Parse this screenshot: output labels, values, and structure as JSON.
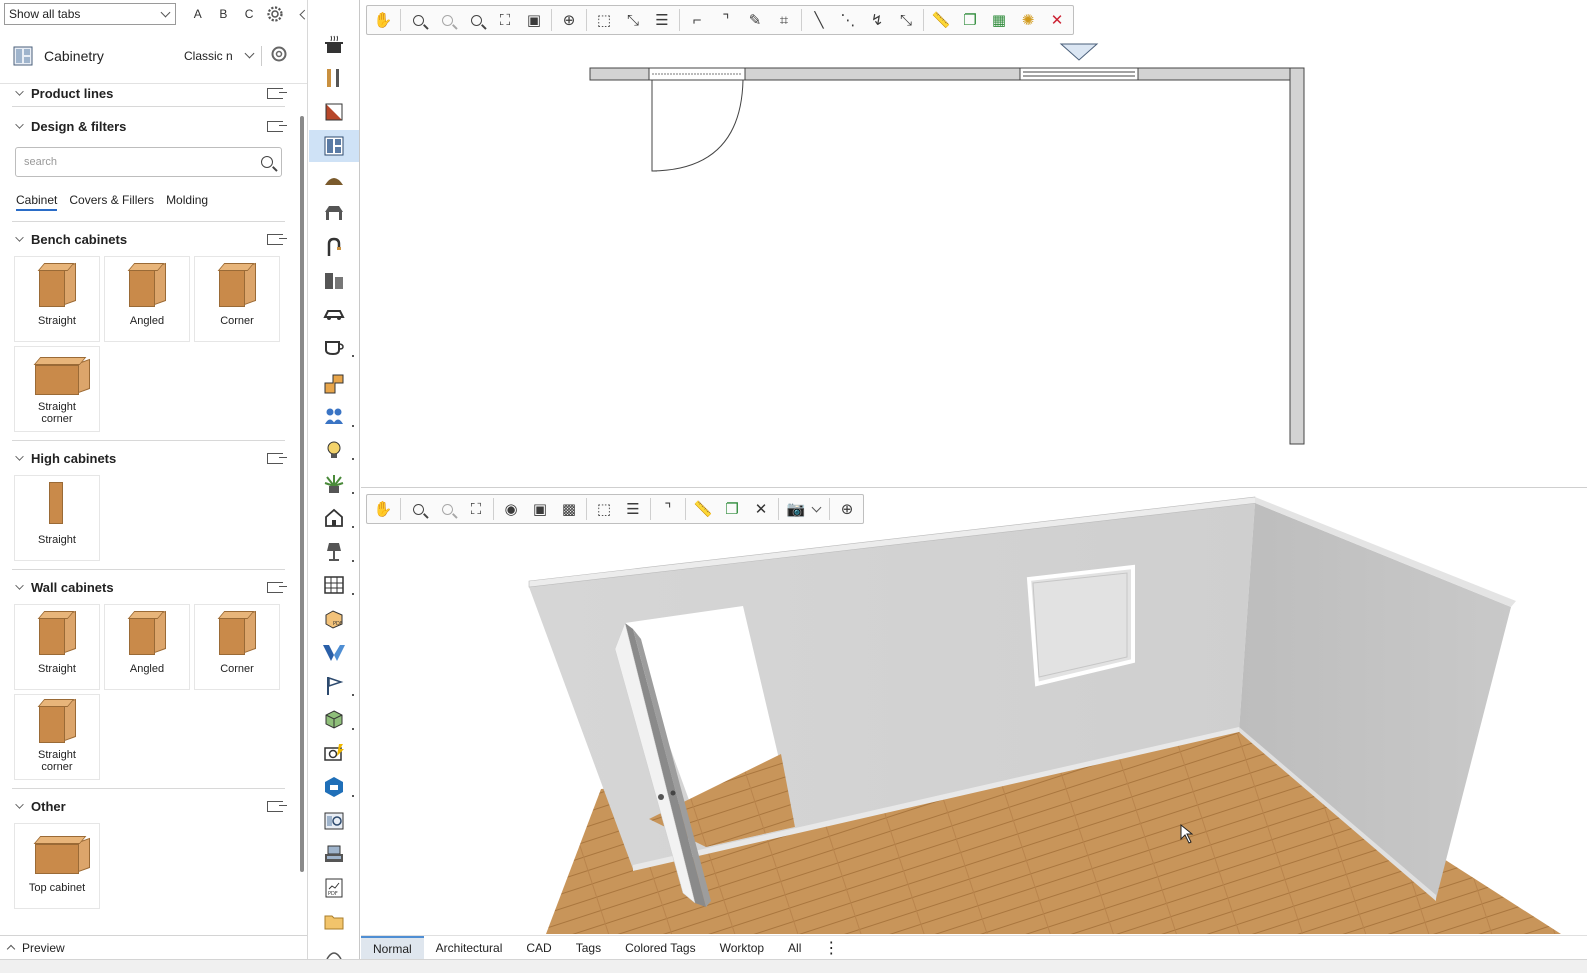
{
  "topbar": {
    "tabs_select_value": "Show all tabs",
    "letters": [
      "A",
      "B",
      "C"
    ]
  },
  "catalog": {
    "title": "Cabinetry",
    "style_value": "Classic n"
  },
  "sections": {
    "product_lines": "Product lines",
    "design_filters": "Design & filters",
    "search_placeholder": "search",
    "subtabs": [
      "Cabinet",
      "Covers & Fillers",
      "Molding"
    ],
    "bench": {
      "title": "Bench cabinets",
      "items": [
        "Straight",
        "Angled",
        "Corner",
        "Straight corner"
      ]
    },
    "high": {
      "title": "High cabinets",
      "items": [
        "Straight"
      ]
    },
    "wall": {
      "title": "Wall cabinets",
      "items": [
        "Straight",
        "Angled",
        "Corner",
        "Straight corner"
      ]
    },
    "other": {
      "title": "Other",
      "items": [
        "Top cabinet"
      ]
    }
  },
  "preview_label": "Preview",
  "strip_icons": [
    "pot-icon",
    "tools-icon",
    "wall-brick-icon",
    "cabinet-layout-icon",
    "arch-icon",
    "bench-icon",
    "faucet-icon",
    "bathroom-icon",
    "car-icon",
    "cup-icon",
    "floorplan-icon",
    "people-icon",
    "bulb-icon",
    "plant-icon",
    "house-icon",
    "lamp-icon",
    "building-icon",
    "pdf-box-icon",
    "v-logo-icon",
    "flag-icon",
    "cubes-icon",
    "camera-icon",
    "sketchup-icon",
    "catalog-icon",
    "printer-icon",
    "pdf-chart-icon",
    "folder-icon",
    "circle-icon"
  ],
  "bottom_tabs": [
    "Normal",
    "Architectural",
    "CAD",
    "Tags",
    "Colored Tags",
    "Worktop",
    "All"
  ],
  "colors": {
    "accent": "#2a6cc7",
    "selected_tab_bg": "#dfe6ee",
    "wood": "#c98a4a",
    "floor": "#c8955a"
  }
}
